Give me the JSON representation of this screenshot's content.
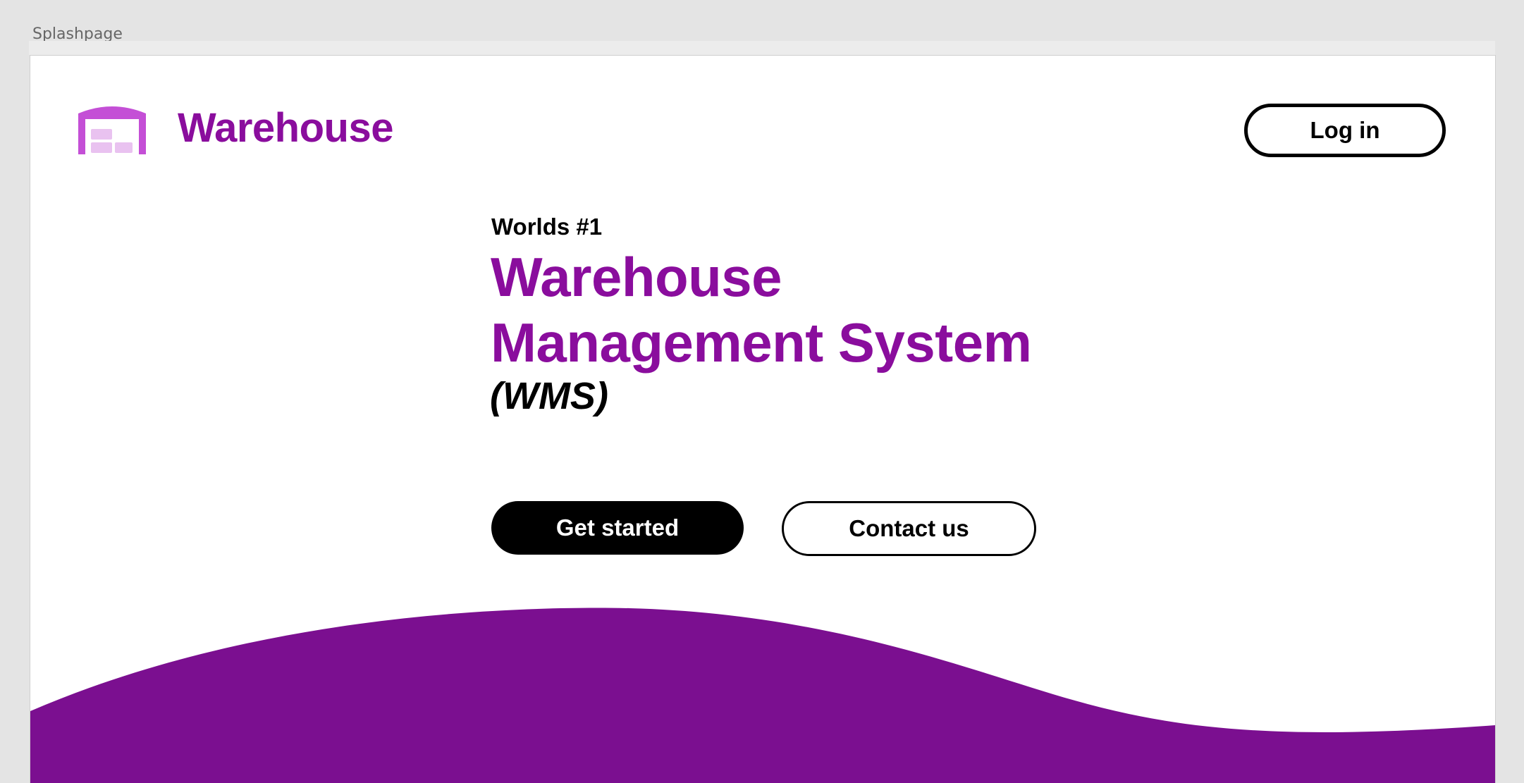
{
  "frame": {
    "label": "Splashpage"
  },
  "header": {
    "brand_name": "Warehouse",
    "logo_icon": "warehouse-icon",
    "login_label": "Log in"
  },
  "hero": {
    "eyebrow": "Worlds #1",
    "headline_line1": "Warehouse",
    "headline_line2": "Management System",
    "acronym": "(WMS)",
    "primary_cta": "Get started",
    "secondary_cta": "Contact us"
  },
  "colors": {
    "brand": "#8a0d9d",
    "logo": "#c44fd6",
    "logo_light": "#e9c2f0",
    "wave": "#7b0f90",
    "primary_button": "#000000"
  }
}
